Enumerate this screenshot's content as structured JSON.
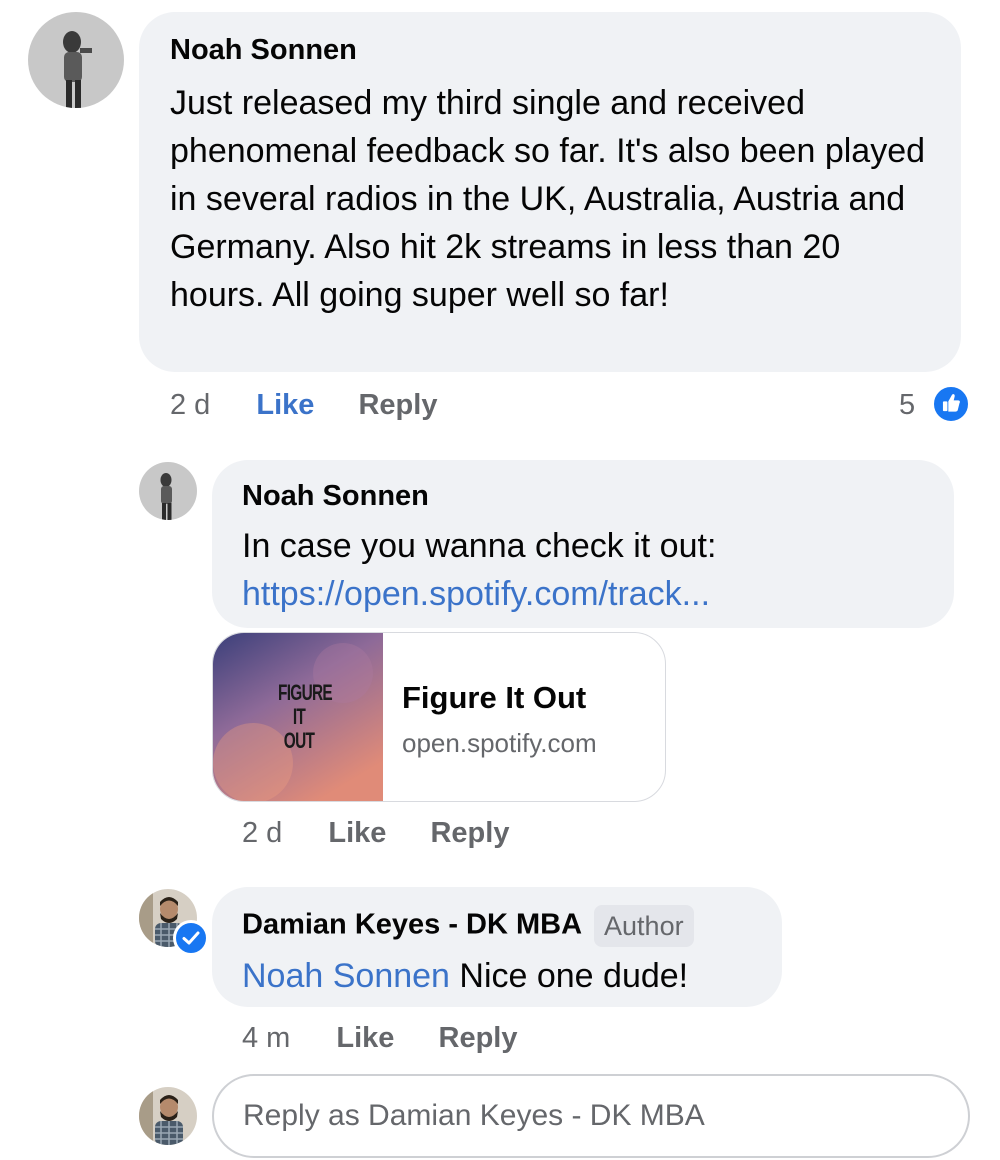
{
  "comment1": {
    "author": "Noah Sonnen",
    "text": "Just released my third single and received phenomenal feedback so far. It's also been played in several radios in the UK, Australia, Austria and Germany. Also hit 2k streams in less than 20 hours. All going super well so far!",
    "time": "2 d",
    "like_label": "Like",
    "reply_label": "Reply",
    "reaction_count": "5"
  },
  "reply1": {
    "author": "Noah Sonnen",
    "text_prefix": "In case you wanna check it out: ",
    "link_text": "https://open.spotify.com/track...",
    "time": "2 d",
    "like_label": "Like",
    "reply_label": "Reply",
    "preview": {
      "title": "Figure It Out",
      "domain": "open.spotify.com",
      "thumb_text": "FIGURE IT OUT"
    }
  },
  "reply2": {
    "author": "Damian Keyes - DK MBA",
    "author_badge": "Author",
    "mention": "Noah Sonnen",
    "text": " Nice one dude!",
    "time": "4 m",
    "like_label": "Like",
    "reply_label": "Reply"
  },
  "composer": {
    "placeholder": "Reply as Damian Keyes - DK MBA"
  },
  "colors": {
    "link": "#3b73c9",
    "bubble": "#f0f2f5",
    "like_active": "#3b73c9",
    "reaction_badge": "#1877f2"
  },
  "icons": {
    "reaction": "like-thumbs-up-icon",
    "verified": "verified-check-icon"
  }
}
